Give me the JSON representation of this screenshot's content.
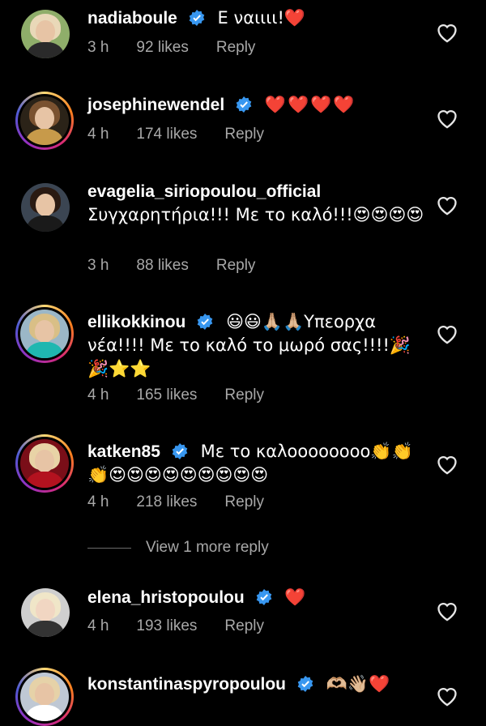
{
  "comments": [
    {
      "username": "nadiaboule",
      "verified": true,
      "text": "Ε ναιιιι!❤️",
      "time": "3 h",
      "likes": "92 likes",
      "reply": "Reply"
    },
    {
      "username": "josephinewendel",
      "verified": true,
      "text": "❤️❤️❤️❤️",
      "time": "4 h",
      "likes": "174 likes",
      "reply": "Reply"
    },
    {
      "username": "evagelia_siriopoulou_official",
      "verified": false,
      "text": "Συγχαρητήρια!!! Με το καλό!!!😍😍😍😍",
      "time": "3 h",
      "likes": "88 likes",
      "reply": "Reply"
    },
    {
      "username": "ellikokkinou",
      "verified": true,
      "text": "😃😃🙏🏼🙏🏼Υπεορχα νέα!!!! Με το καλό το μωρό σας!!!!🎉🎉⭐⭐",
      "time": "4 h",
      "likes": "165 likes",
      "reply": "Reply"
    },
    {
      "username": "katken85",
      "verified": true,
      "text": "Με το καλοοοοοοοο👏👏👏😍😍😍😍😍😍😍😍😍",
      "time": "4 h",
      "likes": "218 likes",
      "reply": "Reply"
    },
    {
      "username": "elena_hristopoulou",
      "verified": true,
      "text": "❤️",
      "time": "4 h",
      "likes": "193 likes",
      "reply": "Reply"
    },
    {
      "username": "konstantinaspyropoulou",
      "verified": true,
      "text": "🫶🏼👋🏼❤️",
      "time": "",
      "likes": "",
      "reply": ""
    }
  ],
  "view_more": "View 1 more reply",
  "icons": {
    "like": "heart-outline-icon",
    "verified": "verified-badge-icon"
  },
  "colors": {
    "background": "#000000",
    "meta": "#a8a8a8",
    "verified": "#3897f0",
    "heart": "#ed2b3b"
  }
}
